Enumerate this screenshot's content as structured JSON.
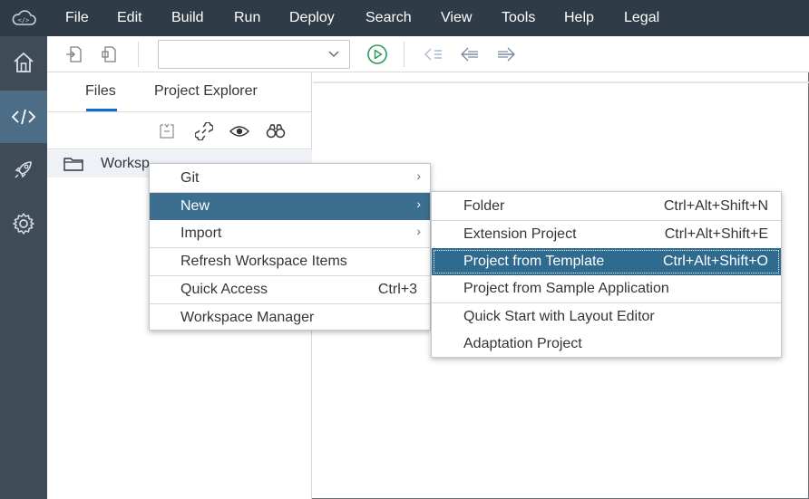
{
  "menubar": {
    "items": [
      "File",
      "Edit",
      "Build",
      "Run",
      "Deploy",
      "Search",
      "View",
      "Tools",
      "Help",
      "Legal"
    ]
  },
  "activitybar": {
    "items": [
      "home-icon",
      "code-icon",
      "rocket-icon",
      "gear-icon"
    ]
  },
  "left_panel": {
    "tabs": [
      {
        "label": "Files"
      },
      {
        "label": "Project Explorer"
      }
    ],
    "workspace_label": "Worksp"
  },
  "context_menu": {
    "items": [
      {
        "label": "Git",
        "shortcut": "",
        "submenu": true
      },
      {
        "label": "New",
        "shortcut": "",
        "submenu": true
      },
      {
        "label": "Import",
        "shortcut": "",
        "submenu": true
      },
      {
        "label": "Refresh Workspace Items",
        "shortcut": "",
        "submenu": false
      },
      {
        "label": "Quick Access",
        "shortcut": "Ctrl+3",
        "submenu": false
      },
      {
        "label": "Workspace Manager",
        "shortcut": "",
        "submenu": false
      }
    ]
  },
  "new_submenu": {
    "items": [
      {
        "label": "Folder",
        "shortcut": "Ctrl+Alt+Shift+N"
      },
      {
        "label": "Extension Project",
        "shortcut": "Ctrl+Alt+Shift+E"
      },
      {
        "label": "Project from Template",
        "shortcut": "Ctrl+Alt+Shift+O"
      },
      {
        "label": "Project from Sample Application",
        "shortcut": ""
      },
      {
        "label": "Quick Start with Layout Editor",
        "shortcut": ""
      },
      {
        "label": "Adaptation Project",
        "shortcut": ""
      }
    ]
  },
  "colors": {
    "menubar_bg": "#2f3c48",
    "activitybar_bg": "#3f4b57",
    "active_item_bg": "#4d6d86",
    "highlight_bg": "#3c6e8f",
    "accent": "#0a6ed1",
    "run_icon": "#2b9d5b"
  }
}
